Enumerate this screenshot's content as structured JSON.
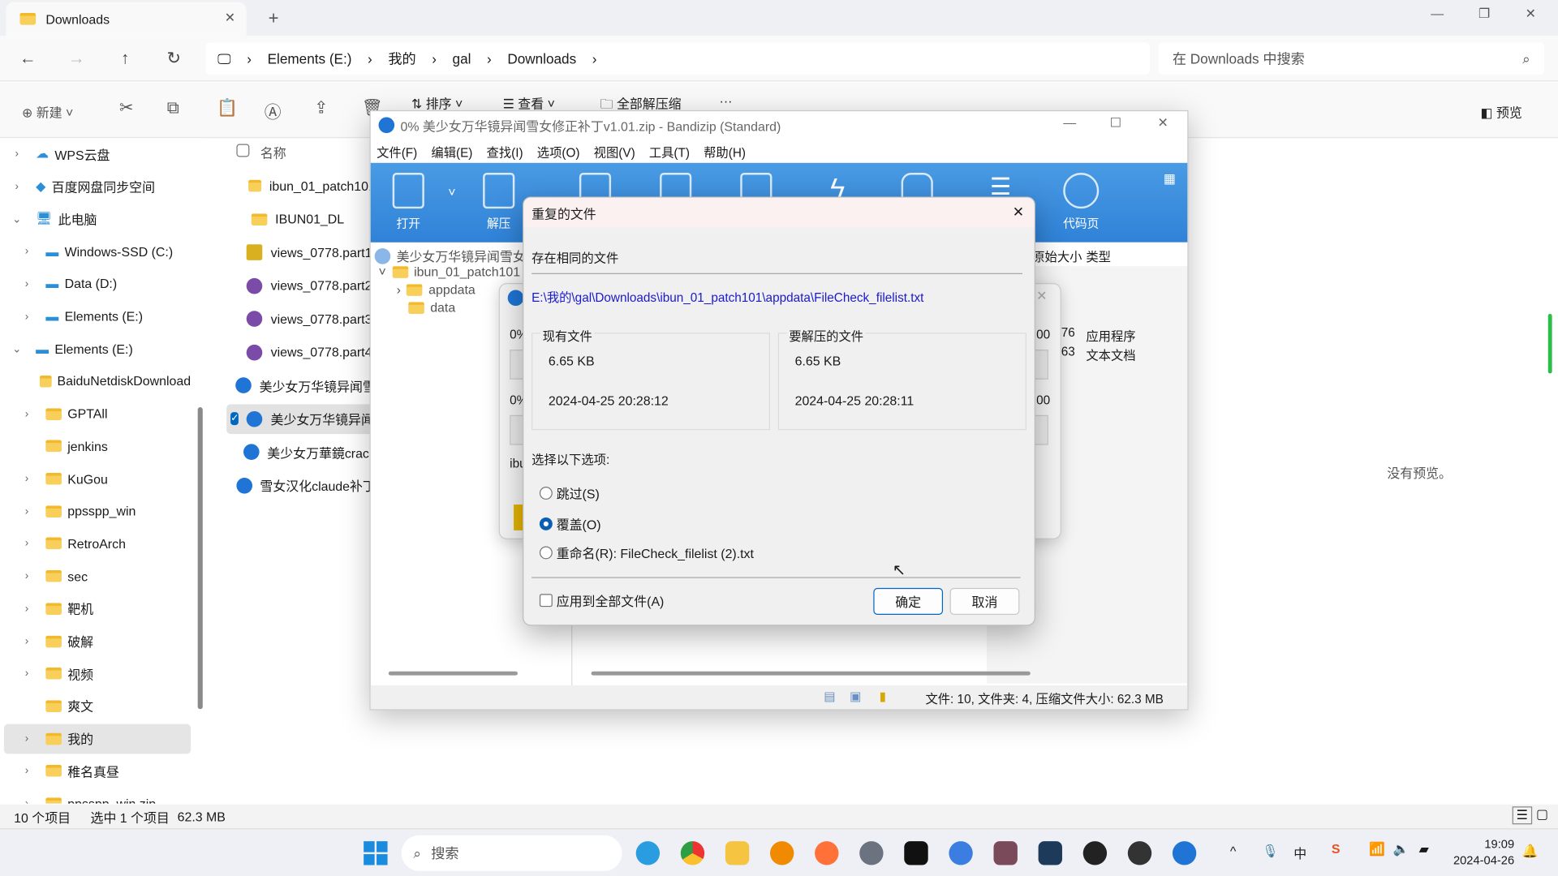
{
  "explorer": {
    "tab_title": "Downloads",
    "breadcrumb": [
      "Elements (E:)",
      "我的",
      "gal",
      "Downloads"
    ],
    "search_placeholder": "在 Downloads 中搜索",
    "toolbar": {
      "new": "新建",
      "sort": "排序",
      "view": "查看",
      "extract_all": "全部解压缩",
      "more": "···",
      "preview": "预览"
    },
    "sidebar": [
      {
        "label": "WPS云盘",
        "expand": ">"
      },
      {
        "label": "百度网盘同步空间",
        "expand": ">"
      },
      {
        "label": "此电脑",
        "expand": "v"
      },
      {
        "label": "Windows-SSD (C:)",
        "expand": ">"
      },
      {
        "label": "Data (D:)",
        "expand": ">"
      },
      {
        "label": "Elements (E:)",
        "expand": ">"
      },
      {
        "label": "Elements (E:)",
        "expand": "v"
      },
      {
        "label": "BaiduNetdiskDownload",
        "expand": ""
      },
      {
        "label": "GPTAll",
        "expand": ">"
      },
      {
        "label": "jenkins",
        "expand": ""
      },
      {
        "label": "KuGou",
        "expand": ">"
      },
      {
        "label": "ppsspp_win",
        "expand": ">"
      },
      {
        "label": "RetroArch",
        "expand": ">"
      },
      {
        "label": "sec",
        "expand": ">"
      },
      {
        "label": "靶机",
        "expand": ">"
      },
      {
        "label": "破解",
        "expand": ">"
      },
      {
        "label": "视频",
        "expand": ">"
      },
      {
        "label": "爽文",
        "expand": ""
      },
      {
        "label": "我的",
        "expand": ">"
      },
      {
        "label": "稚名真昼",
        "expand": ">"
      },
      {
        "label": "ppsspp_win.zip",
        "expand": ">"
      }
    ],
    "column_name": "名称",
    "files": [
      {
        "name": "ibun_01_patch101",
        "icon": "folder"
      },
      {
        "name": "IBUN01_DL",
        "icon": "folder"
      },
      {
        "name": "views_0778.part1.",
        "icon": "winrar"
      },
      {
        "name": "views_0778.part2.",
        "icon": "rar"
      },
      {
        "name": "views_0778.part3.",
        "icon": "rar"
      },
      {
        "name": "views_0778.part4.",
        "icon": "rar"
      },
      {
        "name": "美少女万华镜异闻雪",
        "icon": "zip"
      },
      {
        "name": "美少女万华镜异闻雪",
        "icon": "zip",
        "selected": true
      },
      {
        "name": "美少女万華鏡crack",
        "icon": "zip"
      },
      {
        "name": "雪女汉化claude补丁",
        "icon": "zip"
      }
    ],
    "no_preview": "没有预览。",
    "status": {
      "count": "10 个项目",
      "selected": "选中 1 个项目",
      "size": "62.3 MB"
    }
  },
  "bandizip": {
    "title": "0% 美少女万华镜异闻雪女修正补丁v1.01.zip - Bandizip (Standard)",
    "menu": [
      "文件(F)",
      "编辑(E)",
      "查找(I)",
      "选项(O)",
      "视图(V)",
      "工具(T)",
      "帮助(H)"
    ],
    "toolbar": {
      "open": "打开",
      "extract": "解压",
      "codepage": "代码页"
    },
    "tree": {
      "root": "美少女万华镜异闻雪女修",
      "folder": "ibun_01_patch101",
      "children": [
        "appdata",
        "data"
      ]
    },
    "columns": {
      "orig_size": "原始大小",
      "type": "类型"
    },
    "rows": [
      {
        "size": "76",
        "type": "应用程序"
      },
      {
        "size": "63",
        "type": "文本文档"
      }
    ],
    "progress": {
      "p1": "0%",
      "p2": "0%",
      "v1": "00",
      "v2": "00",
      "file": "ibu"
    },
    "status": "文件: 10, 文件夹: 4, 压缩文件大小: 62.3 MB"
  },
  "dialog": {
    "title": "重复的文件",
    "heading": "存在相同的文件",
    "path": "E:\\我的\\gal\\Downloads\\ibun_01_patch101\\appdata\\FileCheck_filelist.txt",
    "existing": {
      "label": "现有文件",
      "size": "6.65 KB",
      "date": "2024-04-25 20:28:12"
    },
    "incoming": {
      "label": "要解压的文件",
      "size": "6.65 KB",
      "date": "2024-04-25 20:28:11"
    },
    "prompt": "选择以下选项:",
    "options": [
      "跳过(S)",
      "覆盖(O)",
      "重命名(R): FileCheck_filelist (2).txt"
    ],
    "selected_option": "覆盖(O)",
    "apply_all": "应用到全部文件(A)",
    "apply_all_checked": false,
    "ok": "确定",
    "cancel": "取消"
  },
  "taskbar": {
    "search": "搜索",
    "time": "19:09",
    "date": "2024-04-26",
    "ime": "中"
  },
  "colors": {
    "accent": "#0067c0",
    "bandizip_blue": "#3a8ddf",
    "path_link": "#1a1acc"
  }
}
